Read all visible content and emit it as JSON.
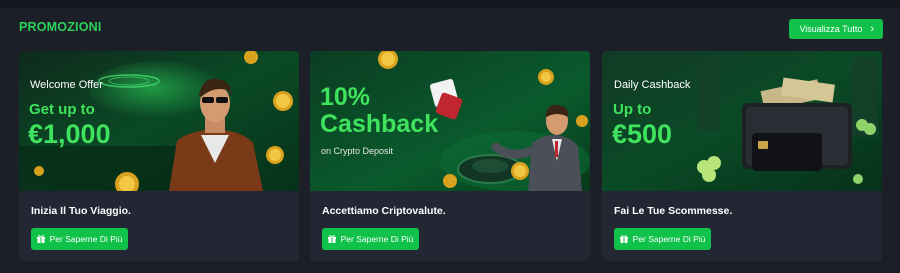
{
  "section": {
    "title": "PROMOZIONI",
    "view_all_label": "Visualizza Tutto"
  },
  "cards": [
    {
      "banner": {
        "small": "Welcome Offer",
        "line1": "Get up to",
        "line2": "€1,000"
      },
      "title": "Inizia Il Tuo Viaggio.",
      "cta": "Per Saperne Di Più"
    },
    {
      "banner": {
        "line1": "10%",
        "line2": "Cashback",
        "sub": "on Crypto Deposit"
      },
      "title": "Accettiamo Criptovalute.",
      "cta": "Per Saperne Di Più"
    },
    {
      "banner": {
        "small": "Daily Cashback",
        "line1": "Up to",
        "line2": "€500"
      },
      "title": "Fai Le Tue Scommesse.",
      "cta": "Per Saperne Di Più"
    }
  ],
  "colors": {
    "accent": "#10c24a",
    "title_green": "#2bd158",
    "banner_text": "#3fe25c",
    "page_bg": "#1c1f28",
    "card_bg": "#232733"
  }
}
